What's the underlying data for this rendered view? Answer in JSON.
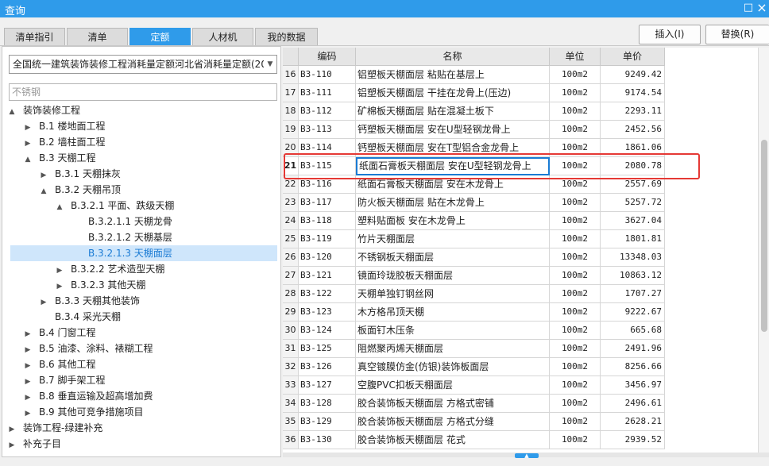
{
  "window": {
    "title": "查询",
    "restore_glyph": "□",
    "close_glyph": "×"
  },
  "tabs": [
    {
      "label": "清单指引"
    },
    {
      "label": "清单"
    },
    {
      "label": "定额",
      "active": true
    },
    {
      "label": "人材机"
    },
    {
      "label": "我的数据"
    }
  ],
  "buttons": {
    "insert": "插入(I)",
    "replace": "替换(R)"
  },
  "left": {
    "quota_set": "全国统一建筑装饰装修工程消耗量定额河北省消耗量定额(20",
    "search_placeholder": "不锈钢",
    "tree": [
      {
        "label": "装饰装修工程",
        "level": 0,
        "toggle": "▲"
      },
      {
        "label": "B.1 楼地面工程",
        "level": 1,
        "toggle": "▶"
      },
      {
        "label": "B.2 墙柱面工程",
        "level": 1,
        "toggle": "▶"
      },
      {
        "label": "B.3 天棚工程",
        "level": 1,
        "toggle": "▲"
      },
      {
        "label": "B.3.1 天棚抹灰",
        "level": 2,
        "toggle": "▶"
      },
      {
        "label": "B.3.2 天棚吊顶",
        "level": 2,
        "toggle": "▲"
      },
      {
        "label": "B.3.2.1 平面、跌级天棚",
        "level": 3,
        "toggle": "▲"
      },
      {
        "label": "B.3.2.1.1 天棚龙骨",
        "level": 4,
        "toggle": ""
      },
      {
        "label": "B.3.2.1.2 天棚基层",
        "level": 4,
        "toggle": ""
      },
      {
        "label": "B.3.2.1.3 天棚面层",
        "level": 4,
        "toggle": "",
        "selected": true
      },
      {
        "label": "B.3.2.2 艺术造型天棚",
        "level": 3,
        "toggle": "▶"
      },
      {
        "label": "B.3.2.3 其他天棚",
        "level": 3,
        "toggle": "▶"
      },
      {
        "label": "B.3.3 天棚其他装饰",
        "level": 2,
        "toggle": "▶"
      },
      {
        "label": "B.3.4 采光天棚",
        "level": 2,
        "toggle": ""
      },
      {
        "label": "B.4 门窗工程",
        "level": 1,
        "toggle": "▶"
      },
      {
        "label": "B.5 油漆、涂料、裱糊工程",
        "level": 1,
        "toggle": "▶"
      },
      {
        "label": "B.6 其他工程",
        "level": 1,
        "toggle": "▶"
      },
      {
        "label": "B.7 脚手架工程",
        "level": 1,
        "toggle": "▶"
      },
      {
        "label": "B.8 垂直运输及超高增加费",
        "level": 1,
        "toggle": "▶"
      },
      {
        "label": "B.9 其他可竞争措施项目",
        "level": 1,
        "toggle": "▶"
      },
      {
        "label": "装饰工程-绿建补充",
        "level": 0,
        "toggle": "▶"
      },
      {
        "label": "补充子目",
        "level": 0,
        "toggle": "▶"
      }
    ]
  },
  "grid": {
    "headers": {
      "code": "编码",
      "name": "名称",
      "unit": "单位",
      "price": "单价"
    },
    "current_index": "21",
    "rows": [
      {
        "idx": "16",
        "code": "B3-110",
        "name": "铝塑板天棚面层 粘贴在基层上",
        "unit": "100m2",
        "price": "9249.42"
      },
      {
        "idx": "17",
        "code": "B3-111",
        "name": "铝塑板天棚面层 干挂在龙骨上(压边)",
        "unit": "100m2",
        "price": "9174.54"
      },
      {
        "idx": "18",
        "code": "B3-112",
        "name": "矿棉板天棚面层 贴在混凝土板下",
        "unit": "100m2",
        "price": "2293.11"
      },
      {
        "idx": "19",
        "code": "B3-113",
        "name": "钙塑板天棚面层 安在U型轻钢龙骨上",
        "unit": "100m2",
        "price": "2452.56"
      },
      {
        "idx": "20",
        "code": "B3-114",
        "name": "钙塑板天棚面层 安在T型铝合金龙骨上",
        "unit": "100m2",
        "price": "1861.06"
      },
      {
        "idx": "21",
        "code": "B3-115",
        "name": "纸面石膏板天棚面层 安在U型轻钢龙骨上",
        "unit": "100m2",
        "price": "2080.78"
      },
      {
        "idx": "22",
        "code": "B3-116",
        "name": "纸面石膏板天棚面层 安在木龙骨上",
        "unit": "100m2",
        "price": "2557.69"
      },
      {
        "idx": "23",
        "code": "B3-117",
        "name": "防火板天棚面层 贴在木龙骨上",
        "unit": "100m2",
        "price": "5257.72"
      },
      {
        "idx": "24",
        "code": "B3-118",
        "name": "塑料贴面板 安在木龙骨上",
        "unit": "100m2",
        "price": "3627.04"
      },
      {
        "idx": "25",
        "code": "B3-119",
        "name": "竹片天棚面层",
        "unit": "100m2",
        "price": "1801.81"
      },
      {
        "idx": "26",
        "code": "B3-120",
        "name": "不锈钢板天棚面层",
        "unit": "100m2",
        "price": "13348.03"
      },
      {
        "idx": "27",
        "code": "B3-121",
        "name": "镜面玲珑胶板天棚面层",
        "unit": "100m2",
        "price": "10863.12"
      },
      {
        "idx": "28",
        "code": "B3-122",
        "name": "天棚单独钉钢丝网",
        "unit": "100m2",
        "price": "1707.27"
      },
      {
        "idx": "29",
        "code": "B3-123",
        "name": "木方格吊顶天棚",
        "unit": "100m2",
        "price": "9222.67"
      },
      {
        "idx": "30",
        "code": "B3-124",
        "name": "板面钉木压条",
        "unit": "100m2",
        "price": "665.68"
      },
      {
        "idx": "31",
        "code": "B3-125",
        "name": "阻燃聚丙烯天棚面层",
        "unit": "100m2",
        "price": "2491.96"
      },
      {
        "idx": "32",
        "code": "B3-126",
        "name": "真空镀膜仿金(仿银)装饰板面层",
        "unit": "100m2",
        "price": "8256.66"
      },
      {
        "idx": "33",
        "code": "B3-127",
        "name": "空腹PVC扣板天棚面层",
        "unit": "100m2",
        "price": "3456.97"
      },
      {
        "idx": "34",
        "code": "B3-128",
        "name": "胶合装饰板天棚面层 方格式密铺",
        "unit": "100m2",
        "price": "2496.61"
      },
      {
        "idx": "35",
        "code": "B3-129",
        "name": "胶合装饰板天棚面层 方格式分缝",
        "unit": "100m2",
        "price": "2628.21"
      },
      {
        "idx": "36",
        "code": "B3-130",
        "name": "胶合装饰板天棚面层 花式",
        "unit": "100m2",
        "price": "2939.52"
      }
    ]
  },
  "colors": {
    "accent": "#2f9bea",
    "selection": "#cfe6fb",
    "highlight_box": "#e53935"
  }
}
